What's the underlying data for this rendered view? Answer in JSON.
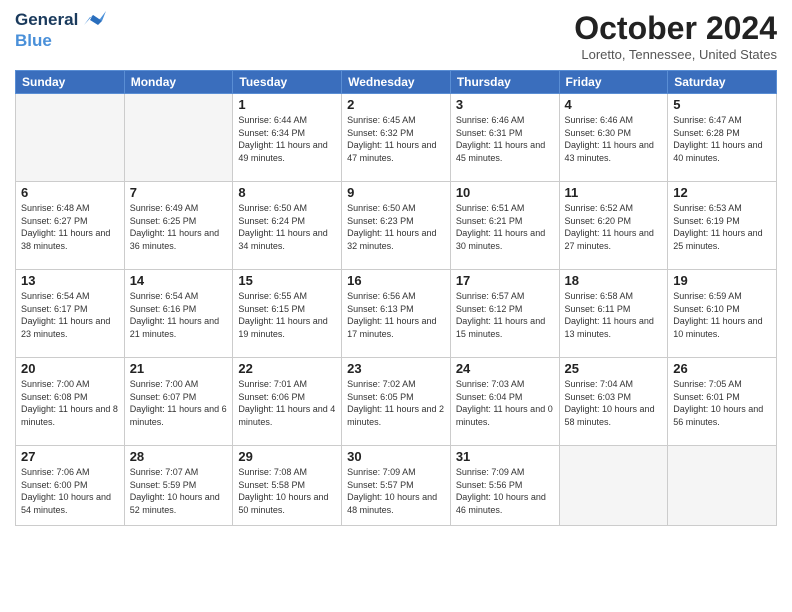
{
  "header": {
    "logo_line1": "General",
    "logo_line2": "Blue",
    "month": "October 2024",
    "location": "Loretto, Tennessee, United States"
  },
  "weekdays": [
    "Sunday",
    "Monday",
    "Tuesday",
    "Wednesday",
    "Thursday",
    "Friday",
    "Saturday"
  ],
  "weeks": [
    [
      {
        "day": "",
        "info": ""
      },
      {
        "day": "",
        "info": ""
      },
      {
        "day": "1",
        "info": "Sunrise: 6:44 AM\nSunset: 6:34 PM\nDaylight: 11 hours and 49 minutes."
      },
      {
        "day": "2",
        "info": "Sunrise: 6:45 AM\nSunset: 6:32 PM\nDaylight: 11 hours and 47 minutes."
      },
      {
        "day": "3",
        "info": "Sunrise: 6:46 AM\nSunset: 6:31 PM\nDaylight: 11 hours and 45 minutes."
      },
      {
        "day": "4",
        "info": "Sunrise: 6:46 AM\nSunset: 6:30 PM\nDaylight: 11 hours and 43 minutes."
      },
      {
        "day": "5",
        "info": "Sunrise: 6:47 AM\nSunset: 6:28 PM\nDaylight: 11 hours and 40 minutes."
      }
    ],
    [
      {
        "day": "6",
        "info": "Sunrise: 6:48 AM\nSunset: 6:27 PM\nDaylight: 11 hours and 38 minutes."
      },
      {
        "day": "7",
        "info": "Sunrise: 6:49 AM\nSunset: 6:25 PM\nDaylight: 11 hours and 36 minutes."
      },
      {
        "day": "8",
        "info": "Sunrise: 6:50 AM\nSunset: 6:24 PM\nDaylight: 11 hours and 34 minutes."
      },
      {
        "day": "9",
        "info": "Sunrise: 6:50 AM\nSunset: 6:23 PM\nDaylight: 11 hours and 32 minutes."
      },
      {
        "day": "10",
        "info": "Sunrise: 6:51 AM\nSunset: 6:21 PM\nDaylight: 11 hours and 30 minutes."
      },
      {
        "day": "11",
        "info": "Sunrise: 6:52 AM\nSunset: 6:20 PM\nDaylight: 11 hours and 27 minutes."
      },
      {
        "day": "12",
        "info": "Sunrise: 6:53 AM\nSunset: 6:19 PM\nDaylight: 11 hours and 25 minutes."
      }
    ],
    [
      {
        "day": "13",
        "info": "Sunrise: 6:54 AM\nSunset: 6:17 PM\nDaylight: 11 hours and 23 minutes."
      },
      {
        "day": "14",
        "info": "Sunrise: 6:54 AM\nSunset: 6:16 PM\nDaylight: 11 hours and 21 minutes."
      },
      {
        "day": "15",
        "info": "Sunrise: 6:55 AM\nSunset: 6:15 PM\nDaylight: 11 hours and 19 minutes."
      },
      {
        "day": "16",
        "info": "Sunrise: 6:56 AM\nSunset: 6:13 PM\nDaylight: 11 hours and 17 minutes."
      },
      {
        "day": "17",
        "info": "Sunrise: 6:57 AM\nSunset: 6:12 PM\nDaylight: 11 hours and 15 minutes."
      },
      {
        "day": "18",
        "info": "Sunrise: 6:58 AM\nSunset: 6:11 PM\nDaylight: 11 hours and 13 minutes."
      },
      {
        "day": "19",
        "info": "Sunrise: 6:59 AM\nSunset: 6:10 PM\nDaylight: 11 hours and 10 minutes."
      }
    ],
    [
      {
        "day": "20",
        "info": "Sunrise: 7:00 AM\nSunset: 6:08 PM\nDaylight: 11 hours and 8 minutes."
      },
      {
        "day": "21",
        "info": "Sunrise: 7:00 AM\nSunset: 6:07 PM\nDaylight: 11 hours and 6 minutes."
      },
      {
        "day": "22",
        "info": "Sunrise: 7:01 AM\nSunset: 6:06 PM\nDaylight: 11 hours and 4 minutes."
      },
      {
        "day": "23",
        "info": "Sunrise: 7:02 AM\nSunset: 6:05 PM\nDaylight: 11 hours and 2 minutes."
      },
      {
        "day": "24",
        "info": "Sunrise: 7:03 AM\nSunset: 6:04 PM\nDaylight: 11 hours and 0 minutes."
      },
      {
        "day": "25",
        "info": "Sunrise: 7:04 AM\nSunset: 6:03 PM\nDaylight: 10 hours and 58 minutes."
      },
      {
        "day": "26",
        "info": "Sunrise: 7:05 AM\nSunset: 6:01 PM\nDaylight: 10 hours and 56 minutes."
      }
    ],
    [
      {
        "day": "27",
        "info": "Sunrise: 7:06 AM\nSunset: 6:00 PM\nDaylight: 10 hours and 54 minutes."
      },
      {
        "day": "28",
        "info": "Sunrise: 7:07 AM\nSunset: 5:59 PM\nDaylight: 10 hours and 52 minutes."
      },
      {
        "day": "29",
        "info": "Sunrise: 7:08 AM\nSunset: 5:58 PM\nDaylight: 10 hours and 50 minutes."
      },
      {
        "day": "30",
        "info": "Sunrise: 7:09 AM\nSunset: 5:57 PM\nDaylight: 10 hours and 48 minutes."
      },
      {
        "day": "31",
        "info": "Sunrise: 7:09 AM\nSunset: 5:56 PM\nDaylight: 10 hours and 46 minutes."
      },
      {
        "day": "",
        "info": ""
      },
      {
        "day": "",
        "info": ""
      }
    ]
  ]
}
